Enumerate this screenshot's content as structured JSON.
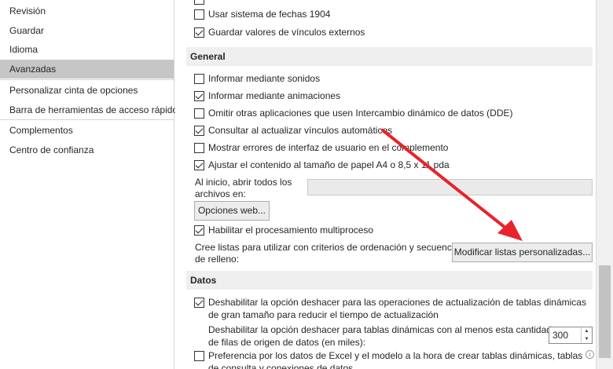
{
  "sidebar": {
    "items": [
      {
        "label": "Revisión"
      },
      {
        "label": "Guardar"
      },
      {
        "label": "Idioma"
      },
      {
        "label": "Avanzadas"
      },
      {
        "label": "Personalizar cinta de opciones"
      },
      {
        "label": "Barra de herramientas de acceso rápido"
      },
      {
        "label": "Complementos"
      },
      {
        "label": "Centro de confianza"
      }
    ],
    "selected": "Avanzadas"
  },
  "main": {
    "top_options": [
      {
        "label": "Usar sistema de fechas 1904",
        "checked": false
      },
      {
        "label": "Guardar valores de vínculos externos",
        "checked": true
      }
    ],
    "general": {
      "header": "General",
      "options": [
        {
          "label": "Informar mediante sonidos",
          "checked": false
        },
        {
          "label": "Informar mediante animaciones",
          "checked": true
        },
        {
          "label": "Omitir otras aplicaciones que usen Intercambio dinámico de datos (DDE)",
          "checked": false
        },
        {
          "label": "Consultar al actualizar vínculos automáticos",
          "checked": true
        },
        {
          "label": "Mostrar errores de interfaz de usuario en el complemento",
          "checked": false
        },
        {
          "label": "Ajustar el contenido al tamaño de papel A4 o 8,5 x 11 pda",
          "checked": true
        }
      ],
      "startup_label_line1": "Al inicio, abrir todos los",
      "startup_label_line2": "archivos en:",
      "startup_value": "",
      "web_options_button": "Opciones web...",
      "multithread": {
        "label": "Habilitar el procesamiento multiproceso",
        "checked": true
      },
      "lists_label_line1": "Cree listas para utilizar con criterios de ordenación y secuencias",
      "lists_label_line2": "de relleno:",
      "custom_lists_button": "Modificar listas personalizadas..."
    },
    "data": {
      "header": "Datos",
      "undo_large": {
        "label": "Deshabilitar la opción deshacer para las operaciones de actualización de tablas dinámicas de gran tamaño para reducir el tiempo de actualización",
        "checked": true
      },
      "undo_rows_line1": "Deshabilitar la opción deshacer para tablas dinámicas con al menos esta cantidad",
      "undo_rows_line2": "de filas de origen de datos (en miles):",
      "undo_rows_value": "300",
      "prefer_excel": {
        "label": "Preferencia por los datos de Excel y el modelo a la hora de crear tablas dinámicas, tablas de consulta y conexiones de datos",
        "checked": false
      }
    }
  },
  "icons": {
    "info": "info-icon",
    "spin_up": "chevron-up-icon",
    "spin_down": "chevron-down-icon"
  },
  "colors": {
    "selected_nav": "#c6c6c6",
    "section_header": "#efefef",
    "arrow": "#e8232c"
  }
}
